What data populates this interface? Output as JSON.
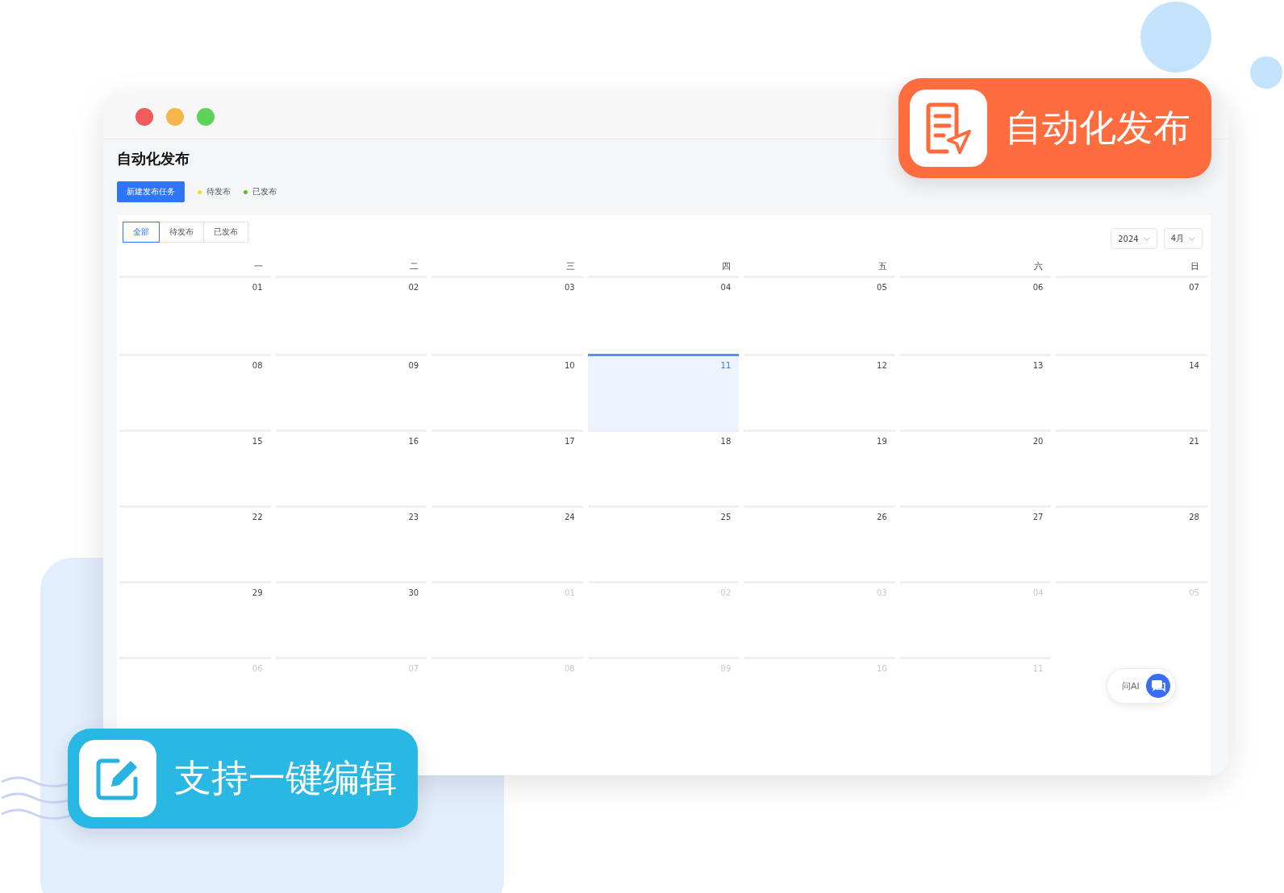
{
  "window": {
    "title": "自动化发布"
  },
  "toolbar": {
    "new_button": "新建发布任务",
    "legend": [
      {
        "label": "待发布",
        "color": "#fadb14"
      },
      {
        "label": "已发布",
        "color": "#52c41a"
      }
    ]
  },
  "filter_tabs": [
    {
      "label": "全部",
      "selected": true
    },
    {
      "label": "待发布",
      "selected": false
    },
    {
      "label": "已发布",
      "selected": false
    }
  ],
  "selects": [
    {
      "value": "2024"
    },
    {
      "value": "4月"
    }
  ],
  "weekdays": [
    "一",
    "二",
    "三",
    "四",
    "五",
    "六",
    "日"
  ],
  "weeks": [
    [
      {
        "day": "01",
        "in_month": true,
        "selected": false
      },
      {
        "day": "02",
        "in_month": true,
        "selected": false
      },
      {
        "day": "03",
        "in_month": true,
        "selected": false
      },
      {
        "day": "04",
        "in_month": true,
        "selected": false
      },
      {
        "day": "05",
        "in_month": true,
        "selected": false
      },
      {
        "day": "06",
        "in_month": true,
        "selected": false
      },
      {
        "day": "07",
        "in_month": true,
        "selected": false
      }
    ],
    [
      {
        "day": "08",
        "in_month": true,
        "selected": false
      },
      {
        "day": "09",
        "in_month": true,
        "selected": false
      },
      {
        "day": "10",
        "in_month": true,
        "selected": false
      },
      {
        "day": "11",
        "in_month": true,
        "selected": true
      },
      {
        "day": "12",
        "in_month": true,
        "selected": false
      },
      {
        "day": "13",
        "in_month": true,
        "selected": false
      },
      {
        "day": "14",
        "in_month": true,
        "selected": false
      }
    ],
    [
      {
        "day": "15",
        "in_month": true,
        "selected": false
      },
      {
        "day": "16",
        "in_month": true,
        "selected": false
      },
      {
        "day": "17",
        "in_month": true,
        "selected": false
      },
      {
        "day": "18",
        "in_month": true,
        "selected": false
      },
      {
        "day": "19",
        "in_month": true,
        "selected": false
      },
      {
        "day": "20",
        "in_month": true,
        "selected": false
      },
      {
        "day": "21",
        "in_month": true,
        "selected": false
      }
    ],
    [
      {
        "day": "22",
        "in_month": true,
        "selected": false
      },
      {
        "day": "23",
        "in_month": true,
        "selected": false
      },
      {
        "day": "24",
        "in_month": true,
        "selected": false
      },
      {
        "day": "25",
        "in_month": true,
        "selected": false
      },
      {
        "day": "26",
        "in_month": true,
        "selected": false
      },
      {
        "day": "27",
        "in_month": true,
        "selected": false
      },
      {
        "day": "28",
        "in_month": true,
        "selected": false
      }
    ],
    [
      {
        "day": "29",
        "in_month": true,
        "selected": false
      },
      {
        "day": "30",
        "in_month": true,
        "selected": false
      },
      {
        "day": "01",
        "in_month": false,
        "selected": false
      },
      {
        "day": "02",
        "in_month": false,
        "selected": false
      },
      {
        "day": "03",
        "in_month": false,
        "selected": false
      },
      {
        "day": "04",
        "in_month": false,
        "selected": false
      },
      {
        "day": "05",
        "in_month": false,
        "selected": false
      }
    ],
    [
      {
        "day": "06",
        "in_month": false,
        "selected": false
      },
      {
        "day": "07",
        "in_month": false,
        "selected": false
      },
      {
        "day": "08",
        "in_month": false,
        "selected": false
      },
      {
        "day": "09",
        "in_month": false,
        "selected": false
      },
      {
        "day": "10",
        "in_month": false,
        "selected": false
      },
      {
        "day": "11",
        "in_month": false,
        "selected": false
      }
    ]
  ],
  "ai_button": {
    "label": "问AI"
  },
  "badges": [
    {
      "kind": "publish",
      "text": "自动化发布"
    },
    {
      "kind": "edit",
      "text": "支持一键编辑"
    }
  ]
}
